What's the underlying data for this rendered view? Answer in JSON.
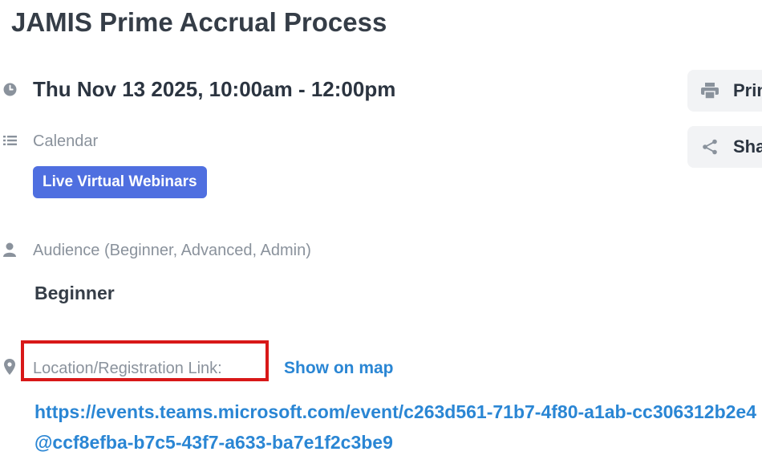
{
  "event": {
    "title": "JAMIS Prime Accrual Process",
    "datetime": "Thu Nov 13 2025, 10:00am - 12:00pm"
  },
  "calendar": {
    "label": "Calendar",
    "badge": "Live Virtual Webinars"
  },
  "audience": {
    "label": "Audience (Beginner, Advanced, Admin)",
    "value": "Beginner"
  },
  "location": {
    "label": "Location/Registration Link:",
    "map_link": "Show on map",
    "url": "https://events.teams.microsoft.com/event/c263d561-71b7-4f80-a1ab-cc306312b2e4@ccf8efba-b7c5-43f7-a633-ba7e1f2c3be9"
  },
  "actions": {
    "print_label": "Print",
    "share_label": "Share"
  },
  "icons": {
    "datetime": "clock-icon",
    "calendar": "list-icon",
    "audience": "person-icon",
    "location": "map-pin-icon",
    "print": "printer-icon",
    "share": "share-icon"
  },
  "colors": {
    "badge_bg": "#4f6fe0",
    "link": "#2a86d4",
    "highlight": "#d81818"
  }
}
